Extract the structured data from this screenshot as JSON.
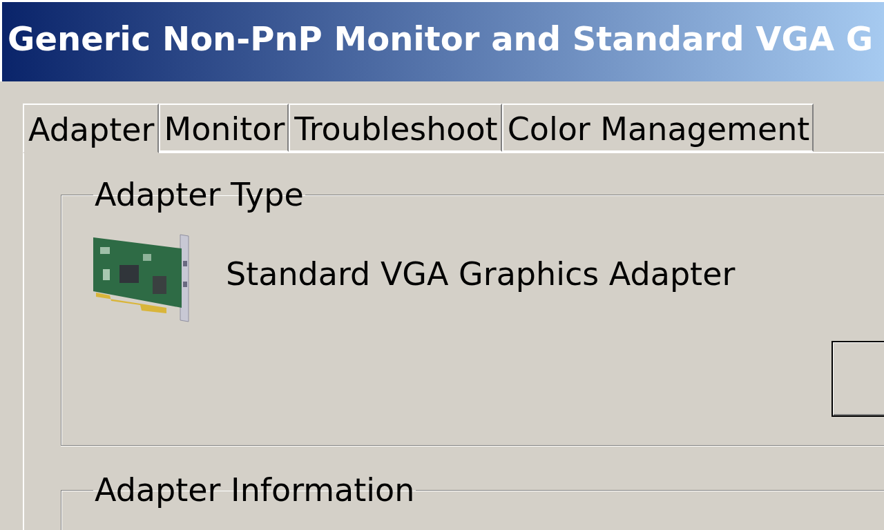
{
  "window": {
    "title": "Generic Non-PnP Monitor and Standard VGA G"
  },
  "tabs": [
    {
      "label": "Adapter",
      "selected": true
    },
    {
      "label": "Monitor",
      "selected": false
    },
    {
      "label": "Troubleshoot",
      "selected": false
    },
    {
      "label": "Color Management",
      "selected": false
    }
  ],
  "groups": [
    {
      "kind": "adapter_type",
      "title": "Adapter Type",
      "adapter_name": "Standard VGA Graphics Adapter"
    },
    {
      "kind": "info",
      "title": "Adapter Information"
    }
  ]
}
